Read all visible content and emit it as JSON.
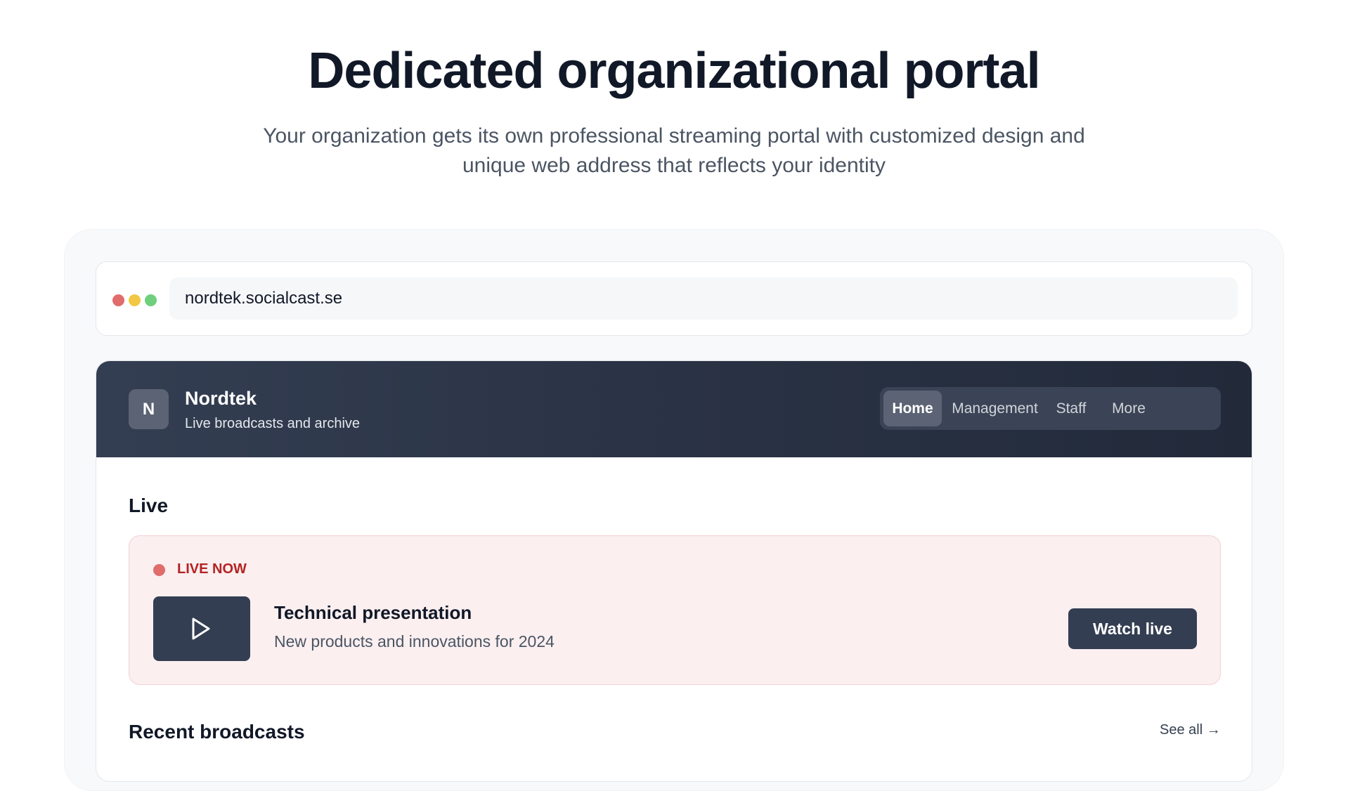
{
  "hero": {
    "title": "Dedicated organizational portal",
    "subtitle": "Your organization gets its own professional streaming portal with customized design and unique web address that reflects your identity"
  },
  "browser": {
    "url": "nordtek.socialcast.se",
    "dot_colors": [
      "#e06c6c",
      "#f2c744",
      "#6fcf7c"
    ]
  },
  "portal": {
    "logo_letter": "N",
    "org_name": "Nordtek",
    "tagline": "Live broadcasts and archive",
    "nav": {
      "items": [
        {
          "label": "Home",
          "active": true
        },
        {
          "label": "Management",
          "active": false
        },
        {
          "label": "Staff",
          "active": false
        },
        {
          "label": "More",
          "active": false
        }
      ]
    },
    "live_section": {
      "title": "Live",
      "badge": "LIVE NOW",
      "broadcast_title": "Technical presentation",
      "broadcast_desc": "New products and innovations for 2024",
      "watch_label": "Watch live",
      "thumbnail_icon": "play-icon"
    },
    "recent_section": {
      "title": "Recent broadcasts",
      "see_all": "See all →"
    }
  },
  "colors": {
    "header_bg": "#2a3345",
    "live_bg": "#fbeff0",
    "live_text": "#b42323",
    "accent_dark": "#343e52"
  }
}
